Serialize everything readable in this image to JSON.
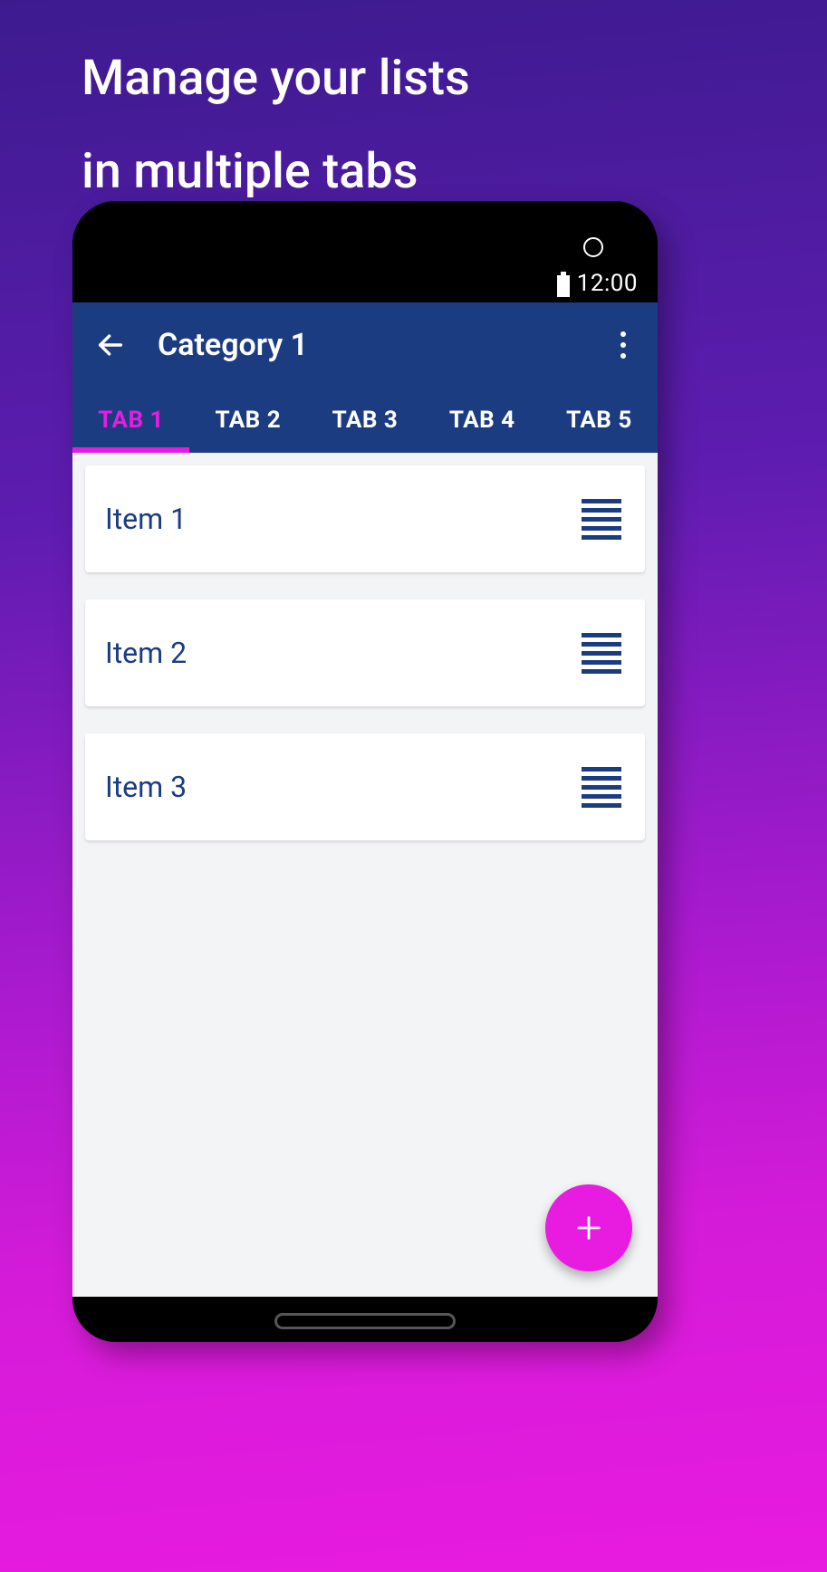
{
  "promo": {
    "line1": "Manage your lists",
    "line2": "in multiple tabs"
  },
  "status": {
    "time": "12:00"
  },
  "appbar": {
    "title": "Category 1"
  },
  "tabs": [
    {
      "label": "TAB 1",
      "active": true
    },
    {
      "label": "TAB 2",
      "active": false
    },
    {
      "label": "TAB 3",
      "active": false
    },
    {
      "label": "TAB 4",
      "active": false
    },
    {
      "label": "TAB 5",
      "active": false
    }
  ],
  "items": [
    {
      "label": "Item 1"
    },
    {
      "label": "Item 2"
    },
    {
      "label": "Item 3"
    }
  ]
}
